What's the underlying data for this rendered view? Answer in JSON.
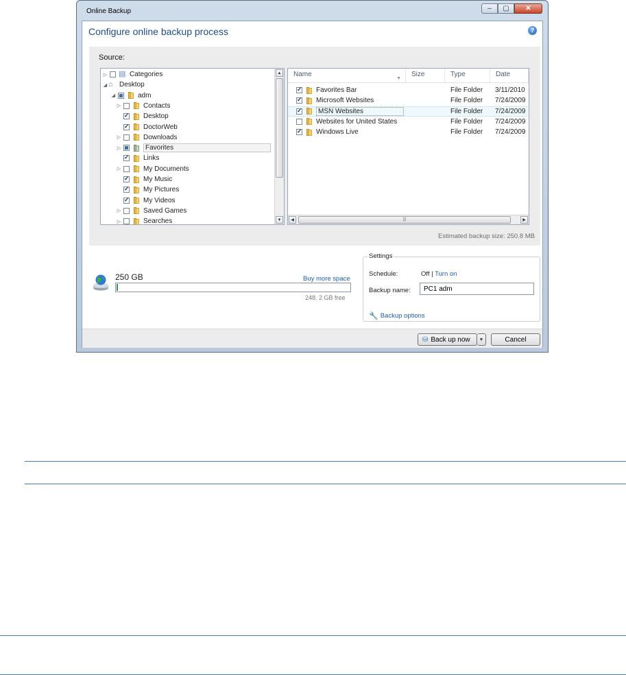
{
  "window": {
    "title": "Online Backup",
    "controls": {
      "minimize": "–",
      "maximize": "▢",
      "close": "✕"
    }
  },
  "header": {
    "title": "Configure online backup process",
    "help_icon": "help-icon"
  },
  "source": {
    "label": "Source:",
    "tree": [
      {
        "label": "Categories",
        "expander": "▷",
        "check": "unchecked",
        "icon": "categories-icon"
      },
      {
        "label": "Desktop",
        "expander": "◢",
        "check": "none",
        "icon": "desktop-icon"
      },
      {
        "label": "adm",
        "expander": "◢",
        "check": "partial",
        "icon": "folder-icon"
      },
      {
        "label": "Contacts",
        "expander": "▷",
        "check": "unchecked",
        "icon": "folder-icon"
      },
      {
        "label": "Desktop",
        "expander": "",
        "check": "checked",
        "icon": "folder-icon"
      },
      {
        "label": "DoctorWeb",
        "expander": "",
        "check": "checked",
        "icon": "folder-icon"
      },
      {
        "label": "Downloads",
        "expander": "▷",
        "check": "unchecked",
        "icon": "folder-icon"
      },
      {
        "label": "Favorites",
        "expander": "▷",
        "check": "partial",
        "icon": "folder-icon",
        "selected": true
      },
      {
        "label": "Links",
        "expander": "",
        "check": "checked",
        "icon": "folder-icon"
      },
      {
        "label": "My Documents",
        "expander": "▷",
        "check": "unchecked",
        "icon": "folder-icon"
      },
      {
        "label": "My Music",
        "expander": "",
        "check": "checked",
        "icon": "folder-icon"
      },
      {
        "label": "My Pictures",
        "expander": "",
        "check": "checked",
        "icon": "folder-icon"
      },
      {
        "label": "My Videos",
        "expander": "",
        "check": "checked",
        "icon": "folder-icon"
      },
      {
        "label": "Saved Games",
        "expander": "▷",
        "check": "unchecked",
        "icon": "folder-icon"
      },
      {
        "label": "Searches",
        "expander": "▷",
        "check": "unchecked",
        "icon": "folder-icon"
      }
    ],
    "list_columns": [
      "Name",
      "Size",
      "Type",
      "Date"
    ],
    "list_rows": [
      {
        "name": "Favorites Bar",
        "size": "",
        "type": "File Folder",
        "date": "3/11/2010",
        "check": "checked"
      },
      {
        "name": "Microsoft Websites",
        "size": "",
        "type": "File Folder",
        "date": "7/24/2009",
        "check": "checked"
      },
      {
        "name": "MSN Websites",
        "size": "",
        "type": "File Folder",
        "date": "7/24/2009",
        "check": "checked",
        "selected": true
      },
      {
        "name": "Websites for United States",
        "size": "",
        "type": "File Folder",
        "date": "7/24/2009",
        "check": "unchecked"
      },
      {
        "name": "Windows Live",
        "size": "",
        "type": "File Folder",
        "date": "7/24/2009",
        "check": "checked"
      }
    ],
    "estimated_size": "Estimated backup size: 250.8 MB"
  },
  "storage": {
    "icon": "online-storage-icon",
    "size": "250 GB",
    "buy_more": "Buy more space",
    "free": "248. 2 GB free",
    "used_fraction": 0.007
  },
  "settings": {
    "legend": "Settings",
    "schedule_label": "Schedule:",
    "schedule_value": "Off",
    "schedule_sep": " | ",
    "turn_on": "Turn on",
    "backup_name_label": "Backup name:",
    "backup_name_value": "PC1 adm",
    "backup_options": "Backup options"
  },
  "footer": {
    "backup_now": "Back up now",
    "cancel": "Cancel"
  },
  "colors": {
    "accent": "#1c5bb0",
    "title": "#1c4b8c",
    "quota": "#2f9c3a"
  }
}
